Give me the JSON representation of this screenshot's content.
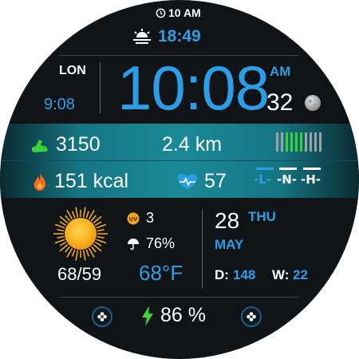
{
  "status": {
    "alarm_icon": "alarm-clock-icon",
    "alarm_time": "10 AM"
  },
  "sunset": {
    "icon": "sunset-icon",
    "time": "18:49"
  },
  "world_clock": {
    "city": "LON",
    "time": "9:08"
  },
  "main_time": {
    "time": "10:08",
    "ampm": "AM",
    "seconds": "32",
    "moon_icon": "moon-icon"
  },
  "activity": {
    "steps_icon": "shoe-icon",
    "steps": "3150",
    "distance": "2.4 km",
    "progress_bars_total": 10,
    "progress_bars_filled": 4,
    "calories_icon": "flame-icon",
    "calories": "151 kcal",
    "heart_icon": "heart-rate-icon",
    "heart_rate": "57",
    "levels": [
      "-L-",
      "-N-",
      "-H-"
    ],
    "active_level": "-L-"
  },
  "weather": {
    "icon": "sun-icon",
    "uv_icon": "uv-icon",
    "uv": "3",
    "rain_icon": "umbrella-icon",
    "rain": "76%",
    "hi_lo": "68/59",
    "temp": "68°F"
  },
  "date": {
    "day": "28",
    "weekday": "THU",
    "month": "MAY",
    "day_label": "D:",
    "day_of_year": "148",
    "week_label": "W:",
    "week": "22"
  },
  "battery": {
    "icon": "bolt-icon",
    "value": "86 %"
  },
  "shortcuts": {
    "left_icon": "flower-icon",
    "right_icon": "flower-icon"
  },
  "colors": {
    "accent": "#2b9ee8",
    "band": "#1a8a98",
    "background": "#101417",
    "steps_green": "#3ad23a",
    "flame": "#ff6a1a"
  }
}
